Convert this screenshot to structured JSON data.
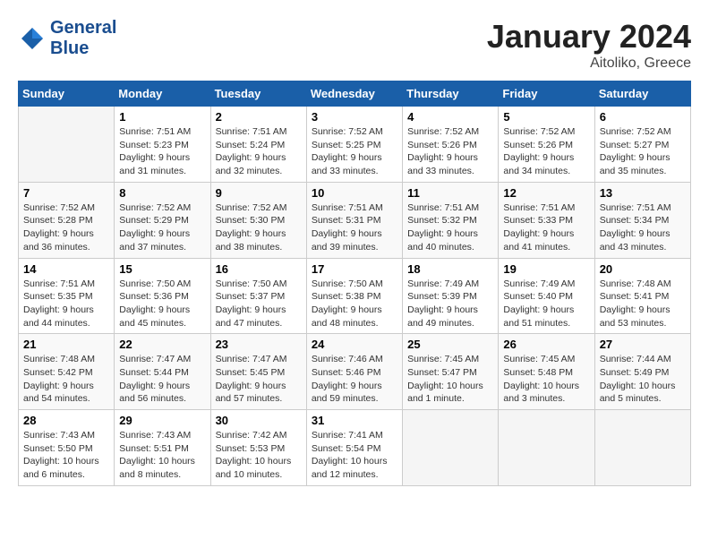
{
  "header": {
    "logo_line1": "General",
    "logo_line2": "Blue",
    "month": "January 2024",
    "location": "Aitoliko, Greece"
  },
  "weekdays": [
    "Sunday",
    "Monday",
    "Tuesday",
    "Wednesday",
    "Thursday",
    "Friday",
    "Saturday"
  ],
  "weeks": [
    [
      {
        "day": "",
        "empty": true
      },
      {
        "day": "1",
        "sunrise": "Sunrise: 7:51 AM",
        "sunset": "Sunset: 5:23 PM",
        "daylight": "Daylight: 9 hours and 31 minutes."
      },
      {
        "day": "2",
        "sunrise": "Sunrise: 7:51 AM",
        "sunset": "Sunset: 5:24 PM",
        "daylight": "Daylight: 9 hours and 32 minutes."
      },
      {
        "day": "3",
        "sunrise": "Sunrise: 7:52 AM",
        "sunset": "Sunset: 5:25 PM",
        "daylight": "Daylight: 9 hours and 33 minutes."
      },
      {
        "day": "4",
        "sunrise": "Sunrise: 7:52 AM",
        "sunset": "Sunset: 5:26 PM",
        "daylight": "Daylight: 9 hours and 33 minutes."
      },
      {
        "day": "5",
        "sunrise": "Sunrise: 7:52 AM",
        "sunset": "Sunset: 5:26 PM",
        "daylight": "Daylight: 9 hours and 34 minutes."
      },
      {
        "day": "6",
        "sunrise": "Sunrise: 7:52 AM",
        "sunset": "Sunset: 5:27 PM",
        "daylight": "Daylight: 9 hours and 35 minutes."
      }
    ],
    [
      {
        "day": "7",
        "sunrise": "Sunrise: 7:52 AM",
        "sunset": "Sunset: 5:28 PM",
        "daylight": "Daylight: 9 hours and 36 minutes."
      },
      {
        "day": "8",
        "sunrise": "Sunrise: 7:52 AM",
        "sunset": "Sunset: 5:29 PM",
        "daylight": "Daylight: 9 hours and 37 minutes."
      },
      {
        "day": "9",
        "sunrise": "Sunrise: 7:52 AM",
        "sunset": "Sunset: 5:30 PM",
        "daylight": "Daylight: 9 hours and 38 minutes."
      },
      {
        "day": "10",
        "sunrise": "Sunrise: 7:51 AM",
        "sunset": "Sunset: 5:31 PM",
        "daylight": "Daylight: 9 hours and 39 minutes."
      },
      {
        "day": "11",
        "sunrise": "Sunrise: 7:51 AM",
        "sunset": "Sunset: 5:32 PM",
        "daylight": "Daylight: 9 hours and 40 minutes."
      },
      {
        "day": "12",
        "sunrise": "Sunrise: 7:51 AM",
        "sunset": "Sunset: 5:33 PM",
        "daylight": "Daylight: 9 hours and 41 minutes."
      },
      {
        "day": "13",
        "sunrise": "Sunrise: 7:51 AM",
        "sunset": "Sunset: 5:34 PM",
        "daylight": "Daylight: 9 hours and 43 minutes."
      }
    ],
    [
      {
        "day": "14",
        "sunrise": "Sunrise: 7:51 AM",
        "sunset": "Sunset: 5:35 PM",
        "daylight": "Daylight: 9 hours and 44 minutes."
      },
      {
        "day": "15",
        "sunrise": "Sunrise: 7:50 AM",
        "sunset": "Sunset: 5:36 PM",
        "daylight": "Daylight: 9 hours and 45 minutes."
      },
      {
        "day": "16",
        "sunrise": "Sunrise: 7:50 AM",
        "sunset": "Sunset: 5:37 PM",
        "daylight": "Daylight: 9 hours and 47 minutes."
      },
      {
        "day": "17",
        "sunrise": "Sunrise: 7:50 AM",
        "sunset": "Sunset: 5:38 PM",
        "daylight": "Daylight: 9 hours and 48 minutes."
      },
      {
        "day": "18",
        "sunrise": "Sunrise: 7:49 AM",
        "sunset": "Sunset: 5:39 PM",
        "daylight": "Daylight: 9 hours and 49 minutes."
      },
      {
        "day": "19",
        "sunrise": "Sunrise: 7:49 AM",
        "sunset": "Sunset: 5:40 PM",
        "daylight": "Daylight: 9 hours and 51 minutes."
      },
      {
        "day": "20",
        "sunrise": "Sunrise: 7:48 AM",
        "sunset": "Sunset: 5:41 PM",
        "daylight": "Daylight: 9 hours and 53 minutes."
      }
    ],
    [
      {
        "day": "21",
        "sunrise": "Sunrise: 7:48 AM",
        "sunset": "Sunset: 5:42 PM",
        "daylight": "Daylight: 9 hours and 54 minutes."
      },
      {
        "day": "22",
        "sunrise": "Sunrise: 7:47 AM",
        "sunset": "Sunset: 5:44 PM",
        "daylight": "Daylight: 9 hours and 56 minutes."
      },
      {
        "day": "23",
        "sunrise": "Sunrise: 7:47 AM",
        "sunset": "Sunset: 5:45 PM",
        "daylight": "Daylight: 9 hours and 57 minutes."
      },
      {
        "day": "24",
        "sunrise": "Sunrise: 7:46 AM",
        "sunset": "Sunset: 5:46 PM",
        "daylight": "Daylight: 9 hours and 59 minutes."
      },
      {
        "day": "25",
        "sunrise": "Sunrise: 7:45 AM",
        "sunset": "Sunset: 5:47 PM",
        "daylight": "Daylight: 10 hours and 1 minute."
      },
      {
        "day": "26",
        "sunrise": "Sunrise: 7:45 AM",
        "sunset": "Sunset: 5:48 PM",
        "daylight": "Daylight: 10 hours and 3 minutes."
      },
      {
        "day": "27",
        "sunrise": "Sunrise: 7:44 AM",
        "sunset": "Sunset: 5:49 PM",
        "daylight": "Daylight: 10 hours and 5 minutes."
      }
    ],
    [
      {
        "day": "28",
        "sunrise": "Sunrise: 7:43 AM",
        "sunset": "Sunset: 5:50 PM",
        "daylight": "Daylight: 10 hours and 6 minutes."
      },
      {
        "day": "29",
        "sunrise": "Sunrise: 7:43 AM",
        "sunset": "Sunset: 5:51 PM",
        "daylight": "Daylight: 10 hours and 8 minutes."
      },
      {
        "day": "30",
        "sunrise": "Sunrise: 7:42 AM",
        "sunset": "Sunset: 5:53 PM",
        "daylight": "Daylight: 10 hours and 10 minutes."
      },
      {
        "day": "31",
        "sunrise": "Sunrise: 7:41 AM",
        "sunset": "Sunset: 5:54 PM",
        "daylight": "Daylight: 10 hours and 12 minutes."
      },
      {
        "day": "",
        "empty": true
      },
      {
        "day": "",
        "empty": true
      },
      {
        "day": "",
        "empty": true
      }
    ]
  ]
}
